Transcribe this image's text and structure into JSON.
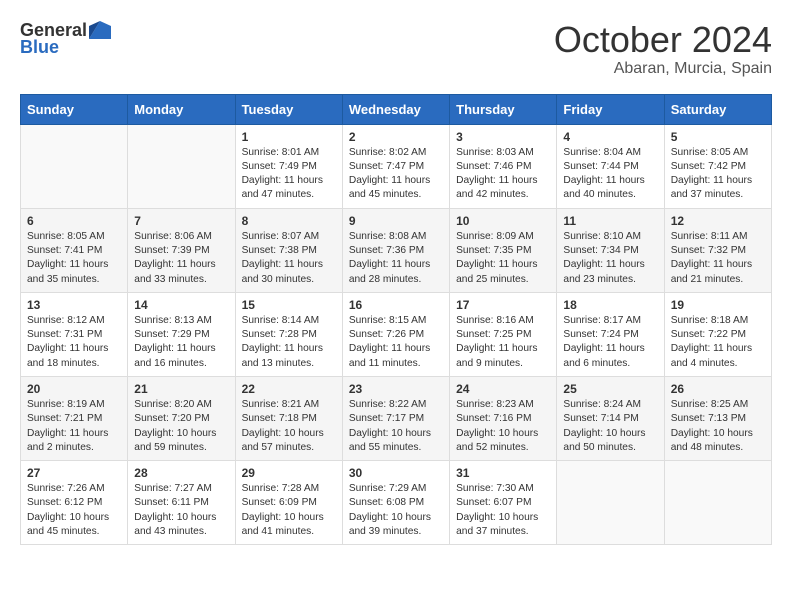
{
  "header": {
    "logo_general": "General",
    "logo_blue": "Blue",
    "month_year": "October 2024",
    "location": "Abaran, Murcia, Spain"
  },
  "weekdays": [
    "Sunday",
    "Monday",
    "Tuesday",
    "Wednesday",
    "Thursday",
    "Friday",
    "Saturday"
  ],
  "weeks": [
    [
      {
        "day": "",
        "text": ""
      },
      {
        "day": "",
        "text": ""
      },
      {
        "day": "1",
        "text": "Sunrise: 8:01 AM\nSunset: 7:49 PM\nDaylight: 11 hours and 47 minutes."
      },
      {
        "day": "2",
        "text": "Sunrise: 8:02 AM\nSunset: 7:47 PM\nDaylight: 11 hours and 45 minutes."
      },
      {
        "day": "3",
        "text": "Sunrise: 8:03 AM\nSunset: 7:46 PM\nDaylight: 11 hours and 42 minutes."
      },
      {
        "day": "4",
        "text": "Sunrise: 8:04 AM\nSunset: 7:44 PM\nDaylight: 11 hours and 40 minutes."
      },
      {
        "day": "5",
        "text": "Sunrise: 8:05 AM\nSunset: 7:42 PM\nDaylight: 11 hours and 37 minutes."
      }
    ],
    [
      {
        "day": "6",
        "text": "Sunrise: 8:05 AM\nSunset: 7:41 PM\nDaylight: 11 hours and 35 minutes."
      },
      {
        "day": "7",
        "text": "Sunrise: 8:06 AM\nSunset: 7:39 PM\nDaylight: 11 hours and 33 minutes."
      },
      {
        "day": "8",
        "text": "Sunrise: 8:07 AM\nSunset: 7:38 PM\nDaylight: 11 hours and 30 minutes."
      },
      {
        "day": "9",
        "text": "Sunrise: 8:08 AM\nSunset: 7:36 PM\nDaylight: 11 hours and 28 minutes."
      },
      {
        "day": "10",
        "text": "Sunrise: 8:09 AM\nSunset: 7:35 PM\nDaylight: 11 hours and 25 minutes."
      },
      {
        "day": "11",
        "text": "Sunrise: 8:10 AM\nSunset: 7:34 PM\nDaylight: 11 hours and 23 minutes."
      },
      {
        "day": "12",
        "text": "Sunrise: 8:11 AM\nSunset: 7:32 PM\nDaylight: 11 hours and 21 minutes."
      }
    ],
    [
      {
        "day": "13",
        "text": "Sunrise: 8:12 AM\nSunset: 7:31 PM\nDaylight: 11 hours and 18 minutes."
      },
      {
        "day": "14",
        "text": "Sunrise: 8:13 AM\nSunset: 7:29 PM\nDaylight: 11 hours and 16 minutes."
      },
      {
        "day": "15",
        "text": "Sunrise: 8:14 AM\nSunset: 7:28 PM\nDaylight: 11 hours and 13 minutes."
      },
      {
        "day": "16",
        "text": "Sunrise: 8:15 AM\nSunset: 7:26 PM\nDaylight: 11 hours and 11 minutes."
      },
      {
        "day": "17",
        "text": "Sunrise: 8:16 AM\nSunset: 7:25 PM\nDaylight: 11 hours and 9 minutes."
      },
      {
        "day": "18",
        "text": "Sunrise: 8:17 AM\nSunset: 7:24 PM\nDaylight: 11 hours and 6 minutes."
      },
      {
        "day": "19",
        "text": "Sunrise: 8:18 AM\nSunset: 7:22 PM\nDaylight: 11 hours and 4 minutes."
      }
    ],
    [
      {
        "day": "20",
        "text": "Sunrise: 8:19 AM\nSunset: 7:21 PM\nDaylight: 11 hours and 2 minutes."
      },
      {
        "day": "21",
        "text": "Sunrise: 8:20 AM\nSunset: 7:20 PM\nDaylight: 10 hours and 59 minutes."
      },
      {
        "day": "22",
        "text": "Sunrise: 8:21 AM\nSunset: 7:18 PM\nDaylight: 10 hours and 57 minutes."
      },
      {
        "day": "23",
        "text": "Sunrise: 8:22 AM\nSunset: 7:17 PM\nDaylight: 10 hours and 55 minutes."
      },
      {
        "day": "24",
        "text": "Sunrise: 8:23 AM\nSunset: 7:16 PM\nDaylight: 10 hours and 52 minutes."
      },
      {
        "day": "25",
        "text": "Sunrise: 8:24 AM\nSunset: 7:14 PM\nDaylight: 10 hours and 50 minutes."
      },
      {
        "day": "26",
        "text": "Sunrise: 8:25 AM\nSunset: 7:13 PM\nDaylight: 10 hours and 48 minutes."
      }
    ],
    [
      {
        "day": "27",
        "text": "Sunrise: 7:26 AM\nSunset: 6:12 PM\nDaylight: 10 hours and 45 minutes."
      },
      {
        "day": "28",
        "text": "Sunrise: 7:27 AM\nSunset: 6:11 PM\nDaylight: 10 hours and 43 minutes."
      },
      {
        "day": "29",
        "text": "Sunrise: 7:28 AM\nSunset: 6:09 PM\nDaylight: 10 hours and 41 minutes."
      },
      {
        "day": "30",
        "text": "Sunrise: 7:29 AM\nSunset: 6:08 PM\nDaylight: 10 hours and 39 minutes."
      },
      {
        "day": "31",
        "text": "Sunrise: 7:30 AM\nSunset: 6:07 PM\nDaylight: 10 hours and 37 minutes."
      },
      {
        "day": "",
        "text": ""
      },
      {
        "day": "",
        "text": ""
      }
    ]
  ]
}
